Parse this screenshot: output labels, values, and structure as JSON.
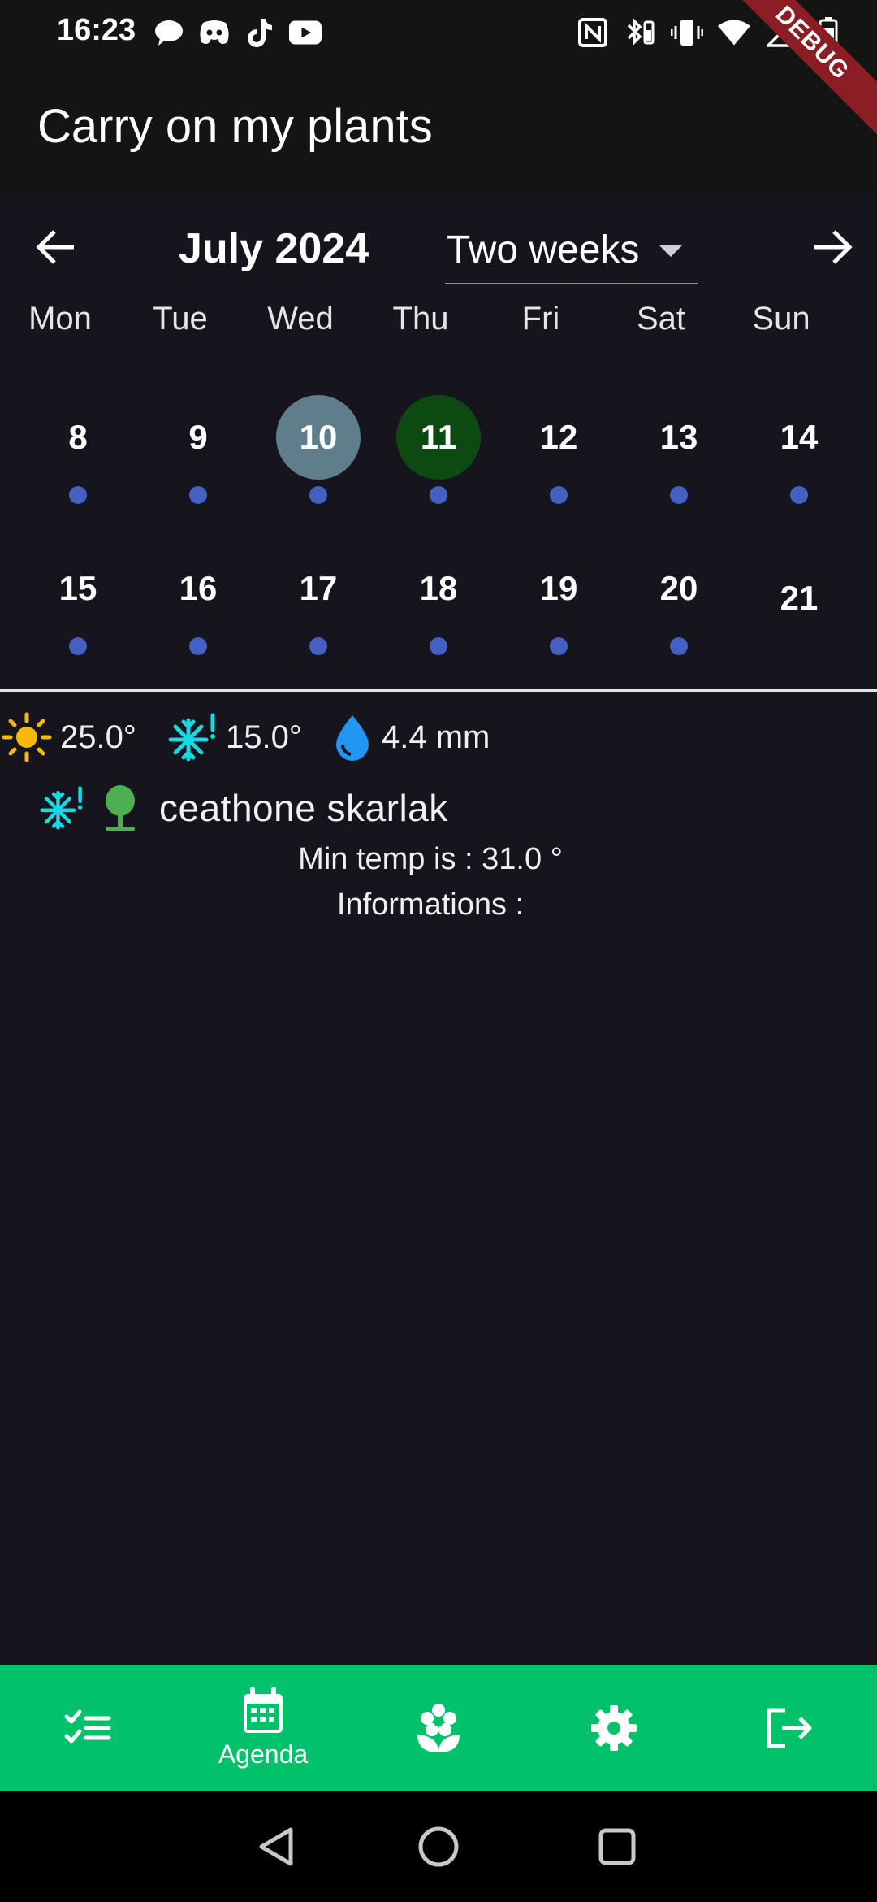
{
  "status_bar": {
    "time": "16:23",
    "left_icons": [
      "chat-bubble-icon",
      "discord-icon",
      "tiktok-icon",
      "youtube-icon"
    ],
    "right_icons": [
      "nfc-icon",
      "bluetooth-battery-icon",
      "vibrate-icon",
      "wifi-icon",
      "signal-icon",
      "battery-icon"
    ]
  },
  "debug_banner": "DEBUG",
  "app_bar": {
    "title": "Carry on my plants"
  },
  "calendar": {
    "month_label": "July 2024",
    "format": "Two weeks",
    "weekdays": [
      "Mon",
      "Tue",
      "Wed",
      "Thu",
      "Fri",
      "Sat",
      "Sun"
    ],
    "weeks": [
      [
        {
          "day": "8",
          "event": true
        },
        {
          "day": "9",
          "event": true
        },
        {
          "day": "10",
          "event": true,
          "state": "selected"
        },
        {
          "day": "11",
          "event": true,
          "state": "today"
        },
        {
          "day": "12",
          "event": true
        },
        {
          "day": "13",
          "event": true
        },
        {
          "day": "14",
          "event": true
        }
      ],
      [
        {
          "day": "15",
          "event": true
        },
        {
          "day": "16",
          "event": true
        },
        {
          "day": "17",
          "event": true
        },
        {
          "day": "18",
          "event": true
        },
        {
          "day": "19",
          "event": true
        },
        {
          "day": "20",
          "event": true
        },
        {
          "day": "21",
          "event": false
        }
      ]
    ],
    "colors": {
      "selected": "#607d8b",
      "today": "#0d4a12",
      "event_dot": "#4560c2"
    }
  },
  "weather": {
    "max_temp": "25.0°",
    "min_temp": "15.0°",
    "rain": "4.4 mm"
  },
  "plant": {
    "name": "ceathone skarlak",
    "min_temp_text": "Min temp is : 31.0 °",
    "informations_text": "Informations :"
  },
  "bottom_nav": {
    "items": [
      {
        "icon": "checklist-icon",
        "label": ""
      },
      {
        "icon": "calendar-icon",
        "label": "Agenda",
        "active": true
      },
      {
        "icon": "flower-icon",
        "label": ""
      },
      {
        "icon": "gear-icon",
        "label": ""
      },
      {
        "icon": "logout-icon",
        "label": ""
      }
    ],
    "background": "#01c16a"
  }
}
